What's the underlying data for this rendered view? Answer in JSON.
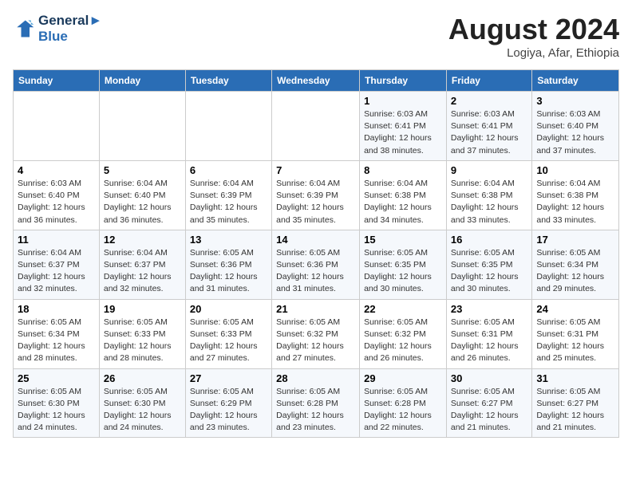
{
  "header": {
    "logo_line1": "General",
    "logo_line2": "Blue",
    "month": "August 2024",
    "location": "Logiya, Afar, Ethiopia"
  },
  "days_of_week": [
    "Sunday",
    "Monday",
    "Tuesday",
    "Wednesday",
    "Thursday",
    "Friday",
    "Saturday"
  ],
  "weeks": [
    [
      {
        "day": "",
        "info": ""
      },
      {
        "day": "",
        "info": ""
      },
      {
        "day": "",
        "info": ""
      },
      {
        "day": "",
        "info": ""
      },
      {
        "day": "1",
        "info": "Sunrise: 6:03 AM\nSunset: 6:41 PM\nDaylight: 12 hours\nand 38 minutes."
      },
      {
        "day": "2",
        "info": "Sunrise: 6:03 AM\nSunset: 6:41 PM\nDaylight: 12 hours\nand 37 minutes."
      },
      {
        "day": "3",
        "info": "Sunrise: 6:03 AM\nSunset: 6:40 PM\nDaylight: 12 hours\nand 37 minutes."
      }
    ],
    [
      {
        "day": "4",
        "info": "Sunrise: 6:03 AM\nSunset: 6:40 PM\nDaylight: 12 hours\nand 36 minutes."
      },
      {
        "day": "5",
        "info": "Sunrise: 6:04 AM\nSunset: 6:40 PM\nDaylight: 12 hours\nand 36 minutes."
      },
      {
        "day": "6",
        "info": "Sunrise: 6:04 AM\nSunset: 6:39 PM\nDaylight: 12 hours\nand 35 minutes."
      },
      {
        "day": "7",
        "info": "Sunrise: 6:04 AM\nSunset: 6:39 PM\nDaylight: 12 hours\nand 35 minutes."
      },
      {
        "day": "8",
        "info": "Sunrise: 6:04 AM\nSunset: 6:38 PM\nDaylight: 12 hours\nand 34 minutes."
      },
      {
        "day": "9",
        "info": "Sunrise: 6:04 AM\nSunset: 6:38 PM\nDaylight: 12 hours\nand 33 minutes."
      },
      {
        "day": "10",
        "info": "Sunrise: 6:04 AM\nSunset: 6:38 PM\nDaylight: 12 hours\nand 33 minutes."
      }
    ],
    [
      {
        "day": "11",
        "info": "Sunrise: 6:04 AM\nSunset: 6:37 PM\nDaylight: 12 hours\nand 32 minutes."
      },
      {
        "day": "12",
        "info": "Sunrise: 6:04 AM\nSunset: 6:37 PM\nDaylight: 12 hours\nand 32 minutes."
      },
      {
        "day": "13",
        "info": "Sunrise: 6:05 AM\nSunset: 6:36 PM\nDaylight: 12 hours\nand 31 minutes."
      },
      {
        "day": "14",
        "info": "Sunrise: 6:05 AM\nSunset: 6:36 PM\nDaylight: 12 hours\nand 31 minutes."
      },
      {
        "day": "15",
        "info": "Sunrise: 6:05 AM\nSunset: 6:35 PM\nDaylight: 12 hours\nand 30 minutes."
      },
      {
        "day": "16",
        "info": "Sunrise: 6:05 AM\nSunset: 6:35 PM\nDaylight: 12 hours\nand 30 minutes."
      },
      {
        "day": "17",
        "info": "Sunrise: 6:05 AM\nSunset: 6:34 PM\nDaylight: 12 hours\nand 29 minutes."
      }
    ],
    [
      {
        "day": "18",
        "info": "Sunrise: 6:05 AM\nSunset: 6:34 PM\nDaylight: 12 hours\nand 28 minutes."
      },
      {
        "day": "19",
        "info": "Sunrise: 6:05 AM\nSunset: 6:33 PM\nDaylight: 12 hours\nand 28 minutes."
      },
      {
        "day": "20",
        "info": "Sunrise: 6:05 AM\nSunset: 6:33 PM\nDaylight: 12 hours\nand 27 minutes."
      },
      {
        "day": "21",
        "info": "Sunrise: 6:05 AM\nSunset: 6:32 PM\nDaylight: 12 hours\nand 27 minutes."
      },
      {
        "day": "22",
        "info": "Sunrise: 6:05 AM\nSunset: 6:32 PM\nDaylight: 12 hours\nand 26 minutes."
      },
      {
        "day": "23",
        "info": "Sunrise: 6:05 AM\nSunset: 6:31 PM\nDaylight: 12 hours\nand 26 minutes."
      },
      {
        "day": "24",
        "info": "Sunrise: 6:05 AM\nSunset: 6:31 PM\nDaylight: 12 hours\nand 25 minutes."
      }
    ],
    [
      {
        "day": "25",
        "info": "Sunrise: 6:05 AM\nSunset: 6:30 PM\nDaylight: 12 hours\nand 24 minutes."
      },
      {
        "day": "26",
        "info": "Sunrise: 6:05 AM\nSunset: 6:30 PM\nDaylight: 12 hours\nand 24 minutes."
      },
      {
        "day": "27",
        "info": "Sunrise: 6:05 AM\nSunset: 6:29 PM\nDaylight: 12 hours\nand 23 minutes."
      },
      {
        "day": "28",
        "info": "Sunrise: 6:05 AM\nSunset: 6:28 PM\nDaylight: 12 hours\nand 23 minutes."
      },
      {
        "day": "29",
        "info": "Sunrise: 6:05 AM\nSunset: 6:28 PM\nDaylight: 12 hours\nand 22 minutes."
      },
      {
        "day": "30",
        "info": "Sunrise: 6:05 AM\nSunset: 6:27 PM\nDaylight: 12 hours\nand 21 minutes."
      },
      {
        "day": "31",
        "info": "Sunrise: 6:05 AM\nSunset: 6:27 PM\nDaylight: 12 hours\nand 21 minutes."
      }
    ]
  ]
}
